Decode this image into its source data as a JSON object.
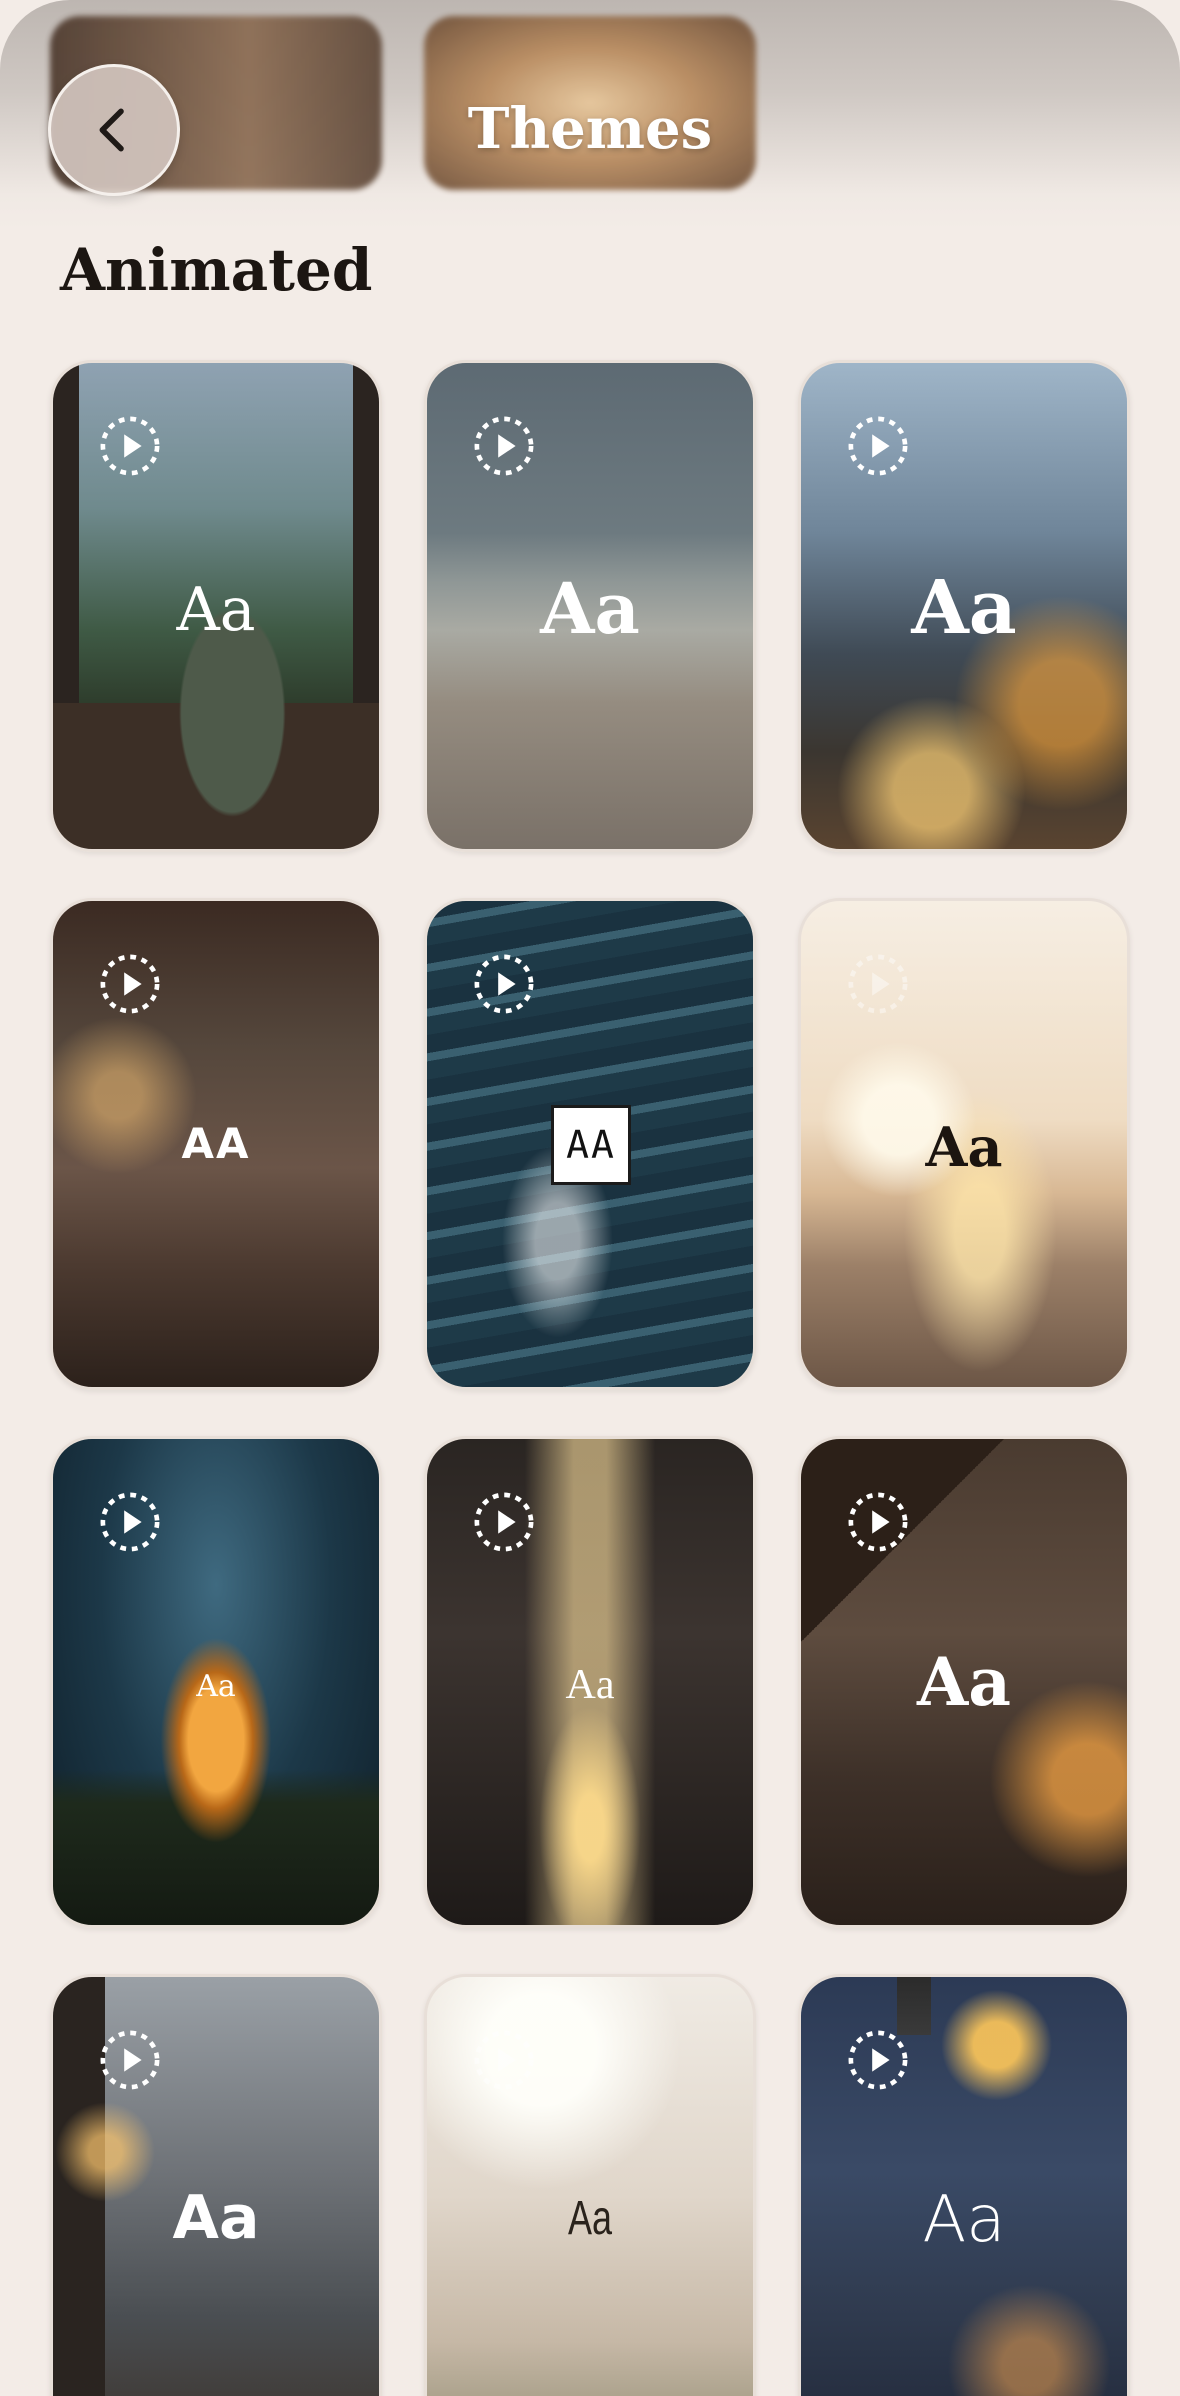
{
  "header": {
    "title": "Themes",
    "back_icon": "chevron-left-icon"
  },
  "section": {
    "title": "Animated"
  },
  "themes": [
    {
      "label": "Aa",
      "style": "serif",
      "scene": "forest cabin window with stove"
    },
    {
      "label": "Aa",
      "style": "serif-bold",
      "scene": "misty beach"
    },
    {
      "label": "Aa",
      "style": "serif-bold",
      "scene": "snowy cabin with candles"
    },
    {
      "label": "AA",
      "style": "sans-caps",
      "scene": "rainy library nook"
    },
    {
      "label": "AA",
      "style": "boxed",
      "scene": "ocean waves"
    },
    {
      "label": "Aa",
      "style": "serif-dark",
      "scene": "sunset beach"
    },
    {
      "label": "Aa",
      "style": "small-serif",
      "scene": "tent under starry sky"
    },
    {
      "label": "Aa",
      "style": "light-serif",
      "scene": "light beam in dark"
    },
    {
      "label": "Aa",
      "style": "serif-bold",
      "scene": "attic bedroom in rain"
    },
    {
      "label": "Aa",
      "style": "rounded",
      "scene": "mountain view with coffee mugs"
    },
    {
      "label": "Aa",
      "style": "condensed-dark",
      "scene": "sunlit window with plants"
    },
    {
      "label": "Aa",
      "style": "light-sans",
      "scene": "rainy city street with lantern"
    }
  ],
  "play_icon": "play-circle-icon"
}
